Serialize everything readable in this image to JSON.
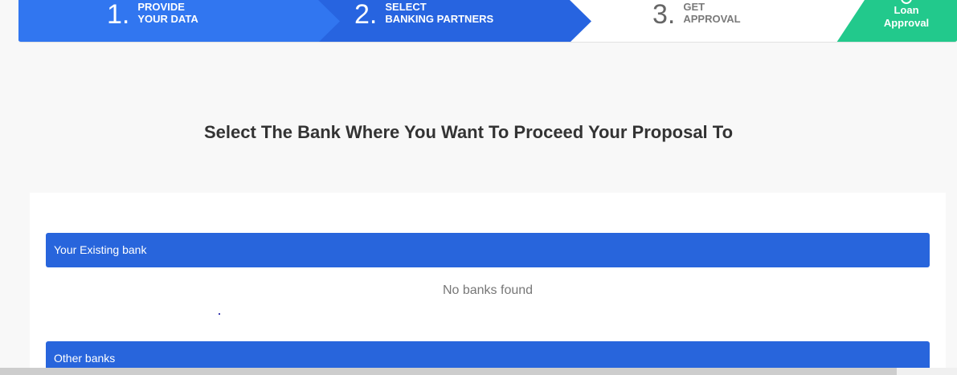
{
  "stepper": {
    "steps": [
      {
        "number": "1.",
        "line1": "PROVIDE",
        "line2": "YOUR DATA"
      },
      {
        "number": "2.",
        "line1": "SELECT",
        "line2": "BANKING PARTNERS"
      },
      {
        "number": "3.",
        "line1": "GET",
        "line2": "APPROVAL"
      }
    ],
    "final": {
      "line1": "Loan",
      "line2": "Approval",
      "icon": "check-circle-icon"
    },
    "colors": {
      "step1": "#3176f0",
      "step2": "#2764e0",
      "final": "#22c98c"
    }
  },
  "page_title": "Select The Bank Where You Want To Proceed Your Proposal To",
  "sections": {
    "existing": {
      "title": "Your Existing bank",
      "empty_message": "No banks found"
    },
    "other": {
      "title": "Other banks"
    }
  },
  "colors": {
    "section_bar": "#2865dc",
    "background": "#f8f8f8"
  }
}
